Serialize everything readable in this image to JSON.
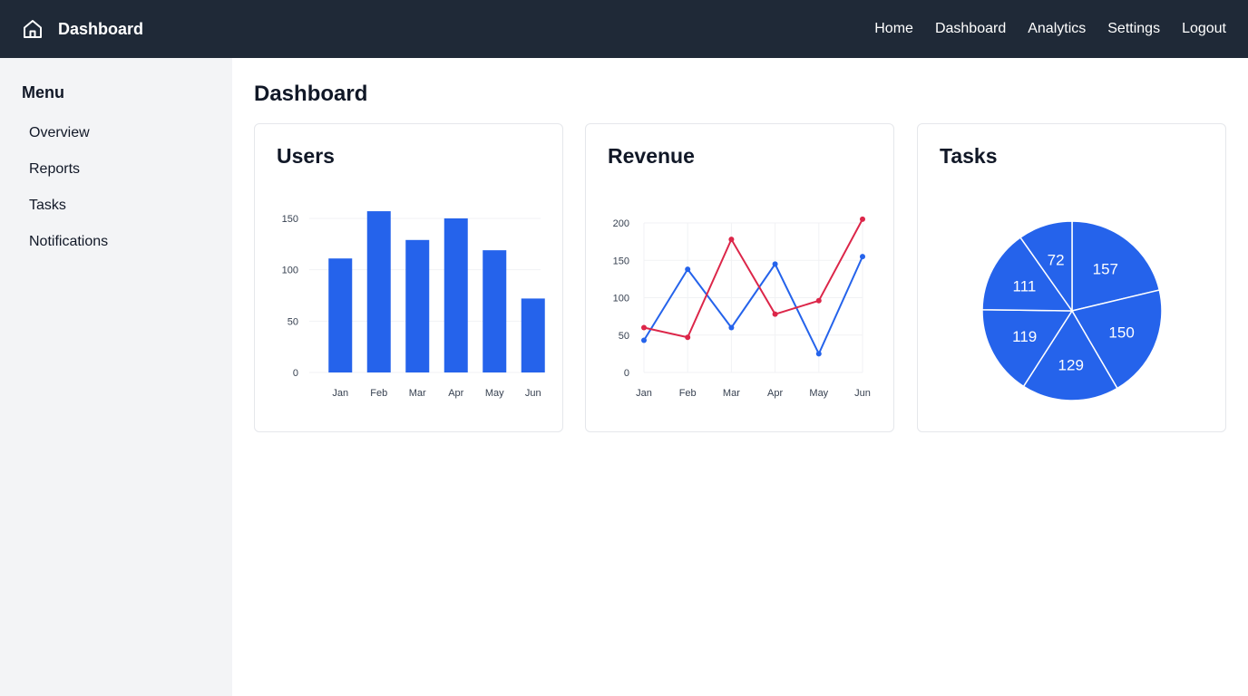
{
  "app": {
    "title": "Dashboard"
  },
  "nav": {
    "items": [
      "Home",
      "Dashboard",
      "Analytics",
      "Settings",
      "Logout"
    ]
  },
  "sidebar": {
    "title": "Menu",
    "items": [
      "Overview",
      "Reports",
      "Tasks",
      "Notifications"
    ]
  },
  "main": {
    "title": "Dashboard"
  },
  "icons": {
    "brand": "home-icon"
  },
  "colors": {
    "blue": "#2563eb",
    "red": "#dc2649",
    "topbar": "#1f2937",
    "sidebar": "#f3f4f6"
  },
  "cards": [
    {
      "title": "Users"
    },
    {
      "title": "Revenue"
    },
    {
      "title": "Tasks"
    }
  ],
  "chart_data": [
    {
      "type": "bar",
      "categories": [
        "Jan",
        "Feb",
        "Mar",
        "Apr",
        "May",
        "Jun"
      ],
      "values": [
        111,
        157,
        129,
        150,
        119,
        72
      ],
      "ylim": [
        0,
        150
      ],
      "yticks": [
        0,
        50,
        100,
        150
      ],
      "grid": true
    },
    {
      "type": "line",
      "categories": [
        "Jan",
        "Feb",
        "Mar",
        "Apr",
        "May",
        "Jun"
      ],
      "series": [
        {
          "values": [
            43,
            138,
            60,
            145,
            25,
            155
          ],
          "color": "#2563eb"
        },
        {
          "values": [
            60,
            47,
            178,
            78,
            96,
            205
          ],
          "color": "#dc2649"
        }
      ],
      "ylim": [
        0,
        200
      ],
      "yticks": [
        0,
        50,
        100,
        150,
        200
      ],
      "grid": true
    },
    {
      "type": "pie",
      "values": [
        157,
        150,
        129,
        119,
        111,
        72
      ],
      "color": "#2563eb"
    }
  ]
}
